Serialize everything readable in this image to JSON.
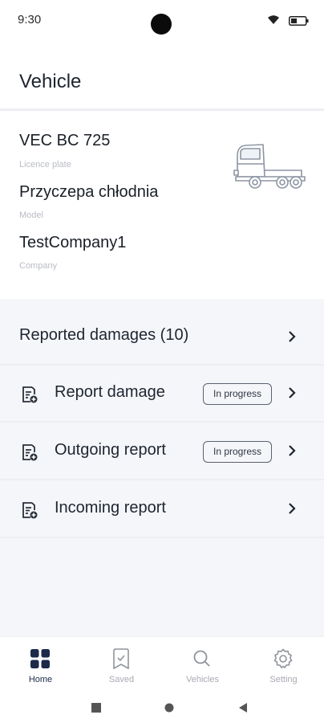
{
  "status_bar": {
    "time": "9:30"
  },
  "header": {
    "title": "Vehicle"
  },
  "vehicle": {
    "fields": [
      {
        "value": "VEC BC 725",
        "caption": "Licence plate"
      },
      {
        "value": "Przyczepa chłodnia",
        "caption": "Model"
      },
      {
        "value": "TestCompany1",
        "caption": "Company"
      }
    ],
    "image_icon": "truck-icon"
  },
  "menu": {
    "reported_damages": {
      "label": "Reported damages (10)"
    },
    "items": [
      {
        "label": "Report damage",
        "badge": "In progress",
        "icon": "document-icon"
      },
      {
        "label": "Outgoing report",
        "badge": "In progress",
        "icon": "document-icon"
      },
      {
        "label": "Incoming report",
        "badge": "",
        "icon": "document-icon"
      }
    ]
  },
  "bottom_nav": {
    "items": [
      {
        "label": "Home",
        "icon": "grid-icon",
        "active": true
      },
      {
        "label": "Saved",
        "icon": "bookmark-icon",
        "active": false
      },
      {
        "label": "Vehicles",
        "icon": "search-icon",
        "active": false
      },
      {
        "label": "Setting",
        "icon": "gear-icon",
        "active": false
      }
    ]
  },
  "colors": {
    "active_nav": "#1c2b4a",
    "inactive_nav": "#a7abb3",
    "content_bg": "#f4f6f9"
  }
}
